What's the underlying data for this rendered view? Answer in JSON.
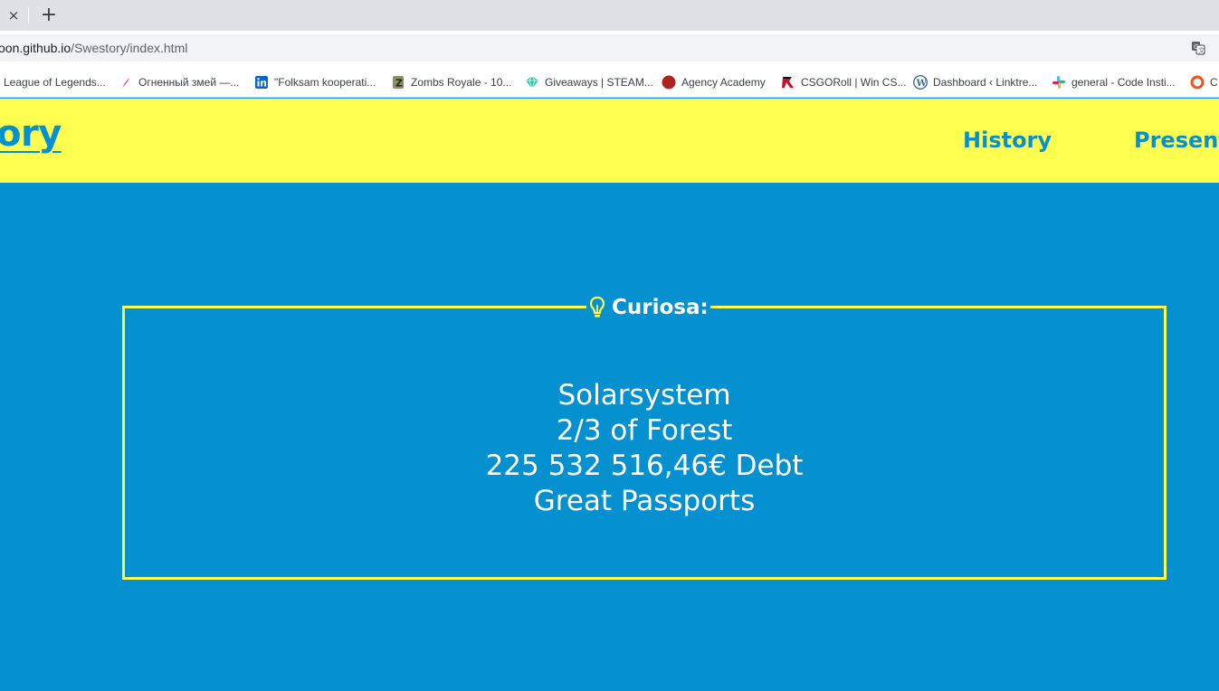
{
  "browser": {
    "tab_close_glyph": "×",
    "new_tab_glyph": "+",
    "url_host": "oon.github.io",
    "url_path": "/Swestory/index.html",
    "bookmarks": [
      {
        "label": "League of Legends...",
        "icon": "lol-icon"
      },
      {
        "label": "Огненный змей —...",
        "icon": "feather-icon"
      },
      {
        "label": "\"Folksam kooperati...",
        "icon": "linkedin-icon"
      },
      {
        "label": "Zombs Royale - 10...",
        "icon": "zombs-icon"
      },
      {
        "label": "Giveaways | STEAM...",
        "icon": "gem-icon"
      },
      {
        "label": "Agency Academy",
        "icon": "red-circle-icon"
      },
      {
        "label": "CSGORoll | Win CS...",
        "icon": "csgoroll-icon"
      },
      {
        "label": "Dashboard ‹ Linktre...",
        "icon": "wordpress-icon"
      },
      {
        "label": "general - Code Insti...",
        "icon": "slack-icon"
      },
      {
        "label": "C",
        "icon": "orange-ring-icon"
      }
    ]
  },
  "site": {
    "logo": "ory",
    "nav": [
      "History",
      "Present"
    ]
  },
  "curiosa": {
    "title": "Curiosa:",
    "facts": [
      "Solarsystem",
      "2/3 of Forest",
      "225 532 516,46€ Debt",
      "Great Passports"
    ]
  },
  "colors": {
    "header_yellow": "#ffff4f",
    "main_blue": "#0590d0",
    "text_white": "#ffffff"
  }
}
